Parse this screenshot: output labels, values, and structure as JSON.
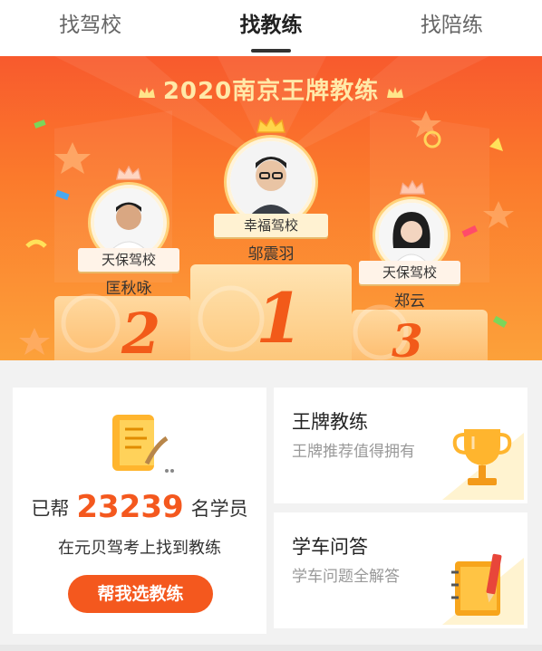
{
  "tabs": [
    {
      "label": "找驾校"
    },
    {
      "label": "找教练"
    },
    {
      "label": "找陪练"
    }
  ],
  "banner": {
    "title": "2020南京王牌教练",
    "coaches": [
      {
        "rank": "1",
        "school": "幸福驾校",
        "name": "邬震羽"
      },
      {
        "rank": "2",
        "school": "天保驾校",
        "name": "匡秋咏"
      },
      {
        "rank": "3",
        "school": "天保驾校",
        "name": "郑云"
      }
    ]
  },
  "stats": {
    "prefix": "已帮",
    "count": "23239",
    "suffix": "名学员",
    "subtitle": "在元贝驾考上找到教练",
    "cta": "帮我选教练"
  },
  "cards": [
    {
      "title": "王牌教练",
      "subtitle": "王牌推荐值得拥有",
      "icon": "trophy-icon"
    },
    {
      "title": "学车问答",
      "subtitle": "学车问题全解答",
      "icon": "notebook-icon"
    }
  ],
  "colors": {
    "accent": "#f4581e",
    "banner_top": "#f85a2d",
    "banner_bottom": "#fca13a"
  }
}
